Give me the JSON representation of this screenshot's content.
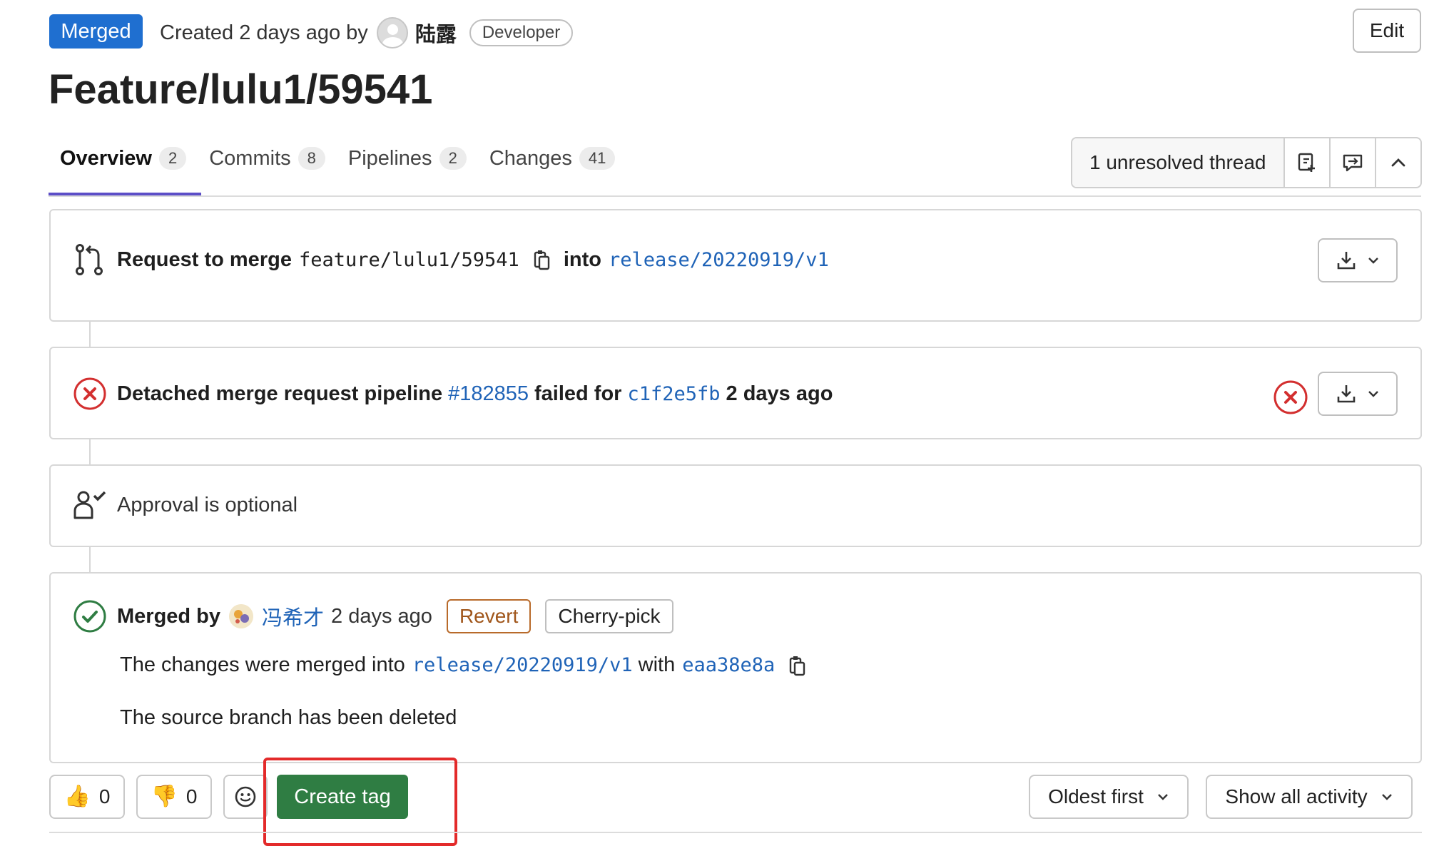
{
  "header": {
    "status_badge": "Merged",
    "created_text": "Created 2 days ago by",
    "author": "陆露",
    "role": "Developer",
    "edit_label": "Edit"
  },
  "title": "Feature/lulu1/59541",
  "tabs": [
    {
      "label": "Overview",
      "count": "2"
    },
    {
      "label": "Commits",
      "count": "8"
    },
    {
      "label": "Pipelines",
      "count": "2"
    },
    {
      "label": "Changes",
      "count": "41"
    }
  ],
  "threads": {
    "label": "1 unresolved thread"
  },
  "merge_request": {
    "prefix": "Request to merge",
    "source_branch": "feature/lulu1/59541",
    "into": "into",
    "target_branch": "release/20220919/v1"
  },
  "pipeline": {
    "prefix": "Detached merge request pipeline",
    "id": "#182855",
    "failed_for": "failed for",
    "commit": "c1f2e5fb",
    "time": "2 days ago"
  },
  "approval": {
    "text": "Approval is optional"
  },
  "merged": {
    "merged_by": "Merged by",
    "user": "冯希才",
    "time": "2 days ago",
    "revert_label": "Revert",
    "cherry_pick_label": "Cherry-pick",
    "changes_prefix": "The changes were merged into",
    "target_branch": "release/20220919/v1",
    "with": "with",
    "commit": "eaa38e8a",
    "source_deleted": "The source branch has been deleted"
  },
  "actions": {
    "thumbs_up_count": "0",
    "thumbs_down_count": "0",
    "create_tag_label": "Create tag",
    "sort_label": "Oldest first",
    "filter_label": "Show all activity"
  },
  "colors": {
    "merged_badge": "#1f6fd0",
    "tab_underline": "#5c4ec7",
    "create_tag": "#2f7d43",
    "highlight_outline": "#e32a2a",
    "failed": "#d32f2f",
    "success": "#2f7d43",
    "link": "#1f63b7"
  }
}
